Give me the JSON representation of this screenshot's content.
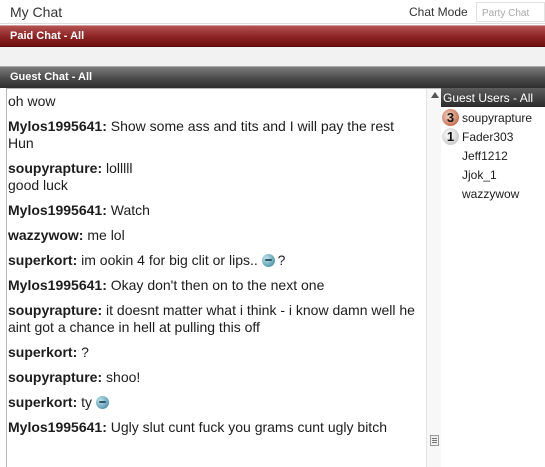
{
  "header": {
    "title": "My Chat",
    "chat_mode_label": "Chat Mode",
    "chat_mode_value": "Party Chat"
  },
  "paid_chat": {
    "title": "Paid Chat - All"
  },
  "guest_chat": {
    "title": "Guest Chat - All",
    "messages": [
      {
        "user": "",
        "text": "oh wow"
      },
      {
        "user": "Mylos1995641",
        "text": "Show some ass and tits and I will pay the rest Hun"
      },
      {
        "user": "soupyrapture",
        "text": "lolllll",
        "text2": "good luck"
      },
      {
        "user": "Mylos1995641",
        "text": "Watch"
      },
      {
        "user": "wazzywow",
        "text": "me lol"
      },
      {
        "user": "superkort",
        "text": "im ookin 4 for big clit or lips..",
        "emoticon": "smiley-icon",
        "text_after": "?"
      },
      {
        "user": "Mylos1995641",
        "text": "Okay don't then on to the next one"
      },
      {
        "user": "soupyrapture",
        "text": "it doesnt matter what i think - i know damn well he aint got a chance in hell at pulling this off"
      },
      {
        "user": "superkort",
        "text": "?"
      },
      {
        "user": "soupyrapture",
        "text": "shoo!"
      },
      {
        "user": "superkort",
        "text": "ty",
        "emoticon": "smiley-icon"
      },
      {
        "user": "Mylos1995641",
        "text": "Ugly slut cunt fuck you grams cunt ugly bitch"
      }
    ]
  },
  "guest_users": {
    "title": "Guest Users - All",
    "users": [
      {
        "name": "soupyrapture",
        "rank": "3"
      },
      {
        "name": "Fader303",
        "rank": "1"
      },
      {
        "name": "Jeff1212",
        "rank": ""
      },
      {
        "name": "Jjok_1",
        "rank": ""
      },
      {
        "name": "wazzywow",
        "rank": ""
      }
    ]
  },
  "colors": {
    "paid_header": "#8c2222",
    "guest_header": "#4a4a4a",
    "rank_3_badge": "#c46b4a",
    "rank_1_badge": "#c9c9c9"
  }
}
